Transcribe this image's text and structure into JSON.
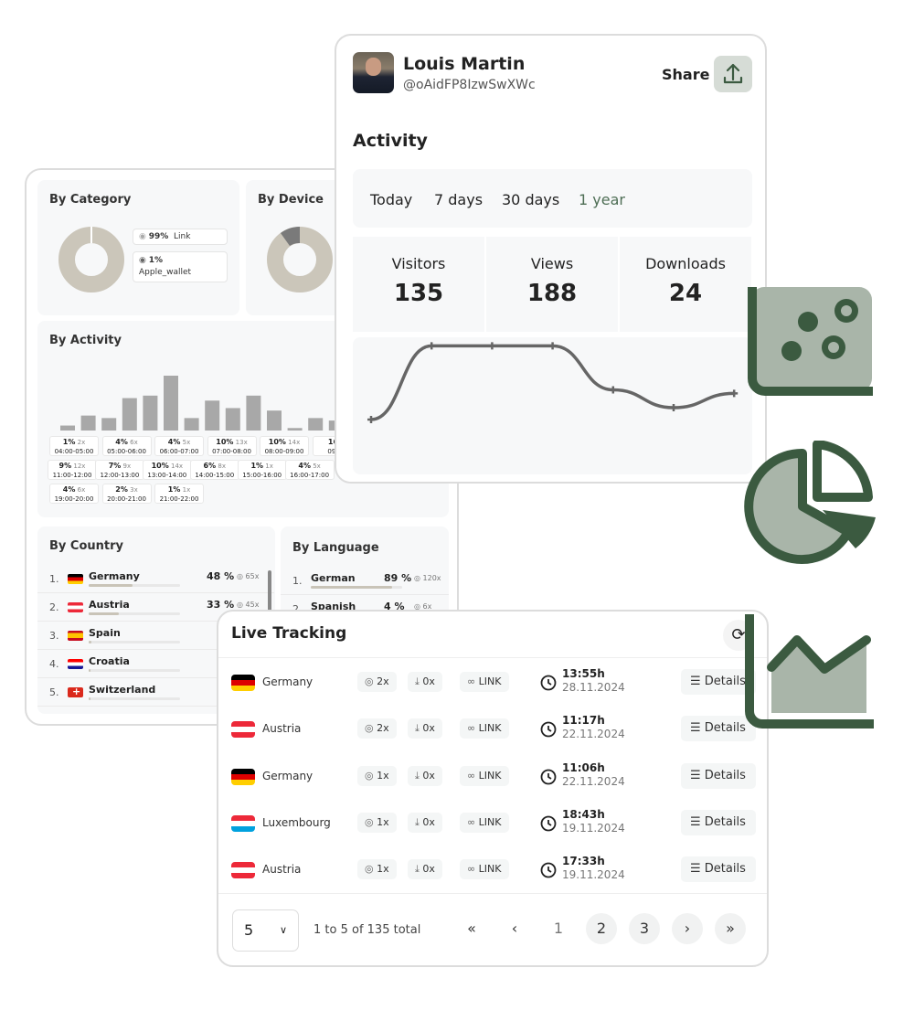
{
  "stats_card": {
    "by_category": {
      "title": "By Category",
      "slices": [
        {
          "label": "Link",
          "pct": "99%",
          "value": 99
        },
        {
          "label": "Apple_wallet",
          "pct": "1%",
          "value": 1
        }
      ]
    },
    "by_device": {
      "title": "By Device",
      "slices": [
        {
          "value": 90
        },
        {
          "value": 10
        }
      ]
    },
    "by_activity": {
      "title": "By Activity",
      "bars": [
        2,
        6,
        5,
        13,
        14,
        22,
        5,
        12,
        9,
        14,
        8,
        1,
        5,
        4
      ],
      "cells": [
        {
          "pct": "1%",
          "count": "2x",
          "range": "04:00-05:00"
        },
        {
          "pct": "4%",
          "count": "6x",
          "range": "05:00-06:00"
        },
        {
          "pct": "4%",
          "count": "5x",
          "range": "06:00-07:00"
        },
        {
          "pct": "10%",
          "count": "13x",
          "range": "07:00-08:00"
        },
        {
          "pct": "10%",
          "count": "14x",
          "range": "08:00-09:00"
        },
        {
          "pct": "16%",
          "count": "",
          "range": "09:00"
        },
        {
          "pct": "9%",
          "count": "12x",
          "range": "11:00-12:00"
        },
        {
          "pct": "7%",
          "count": "9x",
          "range": "12:00-13:00"
        },
        {
          "pct": "10%",
          "count": "14x",
          "range": "13:00-14:00"
        },
        {
          "pct": "6%",
          "count": "8x",
          "range": "14:00-15:00"
        },
        {
          "pct": "1%",
          "count": "1x",
          "range": "15:00-16:00"
        },
        {
          "pct": "4%",
          "count": "5x",
          "range": "16:00-17:00"
        },
        {
          "pct": "4%",
          "count": "6x",
          "range": "19:00-20:00"
        },
        {
          "pct": "2%",
          "count": "3x",
          "range": "20:00-21:00"
        },
        {
          "pct": "1%",
          "count": "1x",
          "range": "21:00-22:00"
        }
      ]
    },
    "by_country": {
      "title": "By Country",
      "rows": [
        {
          "rank": "1.",
          "name": "Germany",
          "pct": "48 %",
          "views": "65x",
          "fill": 48,
          "flag": "de"
        },
        {
          "rank": "2.",
          "name": "Austria",
          "pct": "33 %",
          "views": "45x",
          "fill": 33,
          "flag": "at"
        },
        {
          "rank": "3.",
          "name": "Spain",
          "pct": "",
          "views": "",
          "fill": 3,
          "flag": "es"
        },
        {
          "rank": "4.",
          "name": "Croatia",
          "pct": "",
          "views": "",
          "fill": 2,
          "flag": "hr"
        },
        {
          "rank": "5.",
          "name": "Switzerland",
          "pct": "",
          "views": "",
          "fill": 2,
          "flag": "ch"
        }
      ]
    },
    "by_language": {
      "title": "By Language",
      "rows": [
        {
          "rank": "1.",
          "name": "German",
          "pct": "89 %",
          "views": "120x",
          "fill": 89
        },
        {
          "rank": "2.",
          "name": "Spanish",
          "pct": "4 %",
          "views": "6x",
          "fill": 4
        }
      ]
    }
  },
  "activity_card": {
    "user": {
      "name": "Louis Martin",
      "handle": "@oAidFP8IzwSwXWc"
    },
    "share_label": "Share",
    "title": "Activity",
    "tabs": [
      {
        "label": "Today"
      },
      {
        "label": "7 days"
      },
      {
        "label": "30 days"
      },
      {
        "label": "1 year",
        "active": true
      }
    ],
    "stats": [
      {
        "label": "Visitors",
        "value": "135"
      },
      {
        "label": "Views",
        "value": "188"
      },
      {
        "label": "Downloads",
        "value": "24"
      }
    ],
    "line_values": [
      10,
      72,
      72,
      72,
      35,
      20,
      32
    ]
  },
  "live_tracking": {
    "title": "Live Tracking",
    "rows": [
      {
        "country": "Germany",
        "flag": "de",
        "views": "2x",
        "downloads": "0x",
        "type": "LINK",
        "time": "13:55h",
        "date": "28.11.2024",
        "details": "Details"
      },
      {
        "country": "Austria",
        "flag": "at",
        "views": "2x",
        "downloads": "0x",
        "type": "LINK",
        "time": "11:17h",
        "date": "22.11.2024",
        "details": "Details"
      },
      {
        "country": "Germany",
        "flag": "de",
        "views": "1x",
        "downloads": "0x",
        "type": "LINK",
        "time": "11:06h",
        "date": "22.11.2024",
        "details": "Details"
      },
      {
        "country": "Luxembourg",
        "flag": "lu",
        "views": "1x",
        "downloads": "0x",
        "type": "LINK",
        "time": "18:43h",
        "date": "19.11.2024",
        "details": "Details"
      },
      {
        "country": "Austria",
        "flag": "at",
        "views": "1x",
        "downloads": "0x",
        "type": "LINK",
        "time": "17:33h",
        "date": "19.11.2024",
        "details": "Details"
      }
    ],
    "page_size": "5",
    "range_text": "1 to 5 of 135 total",
    "pages": [
      "1",
      "2",
      "3"
    ],
    "current_page": "1"
  },
  "colors": {
    "accent": "#3b5a40",
    "accent_light": "#a9b5a9",
    "donut": "#cbc6ba",
    "bar": "#a8a8a8",
    "line": "#666666"
  },
  "icons": [
    "scatter-chart-icon",
    "pie-chart-icon",
    "area-chart-icon",
    "share-icon",
    "refresh-icon",
    "eye-icon",
    "download-icon",
    "link-icon",
    "clock-icon",
    "list-icon"
  ]
}
